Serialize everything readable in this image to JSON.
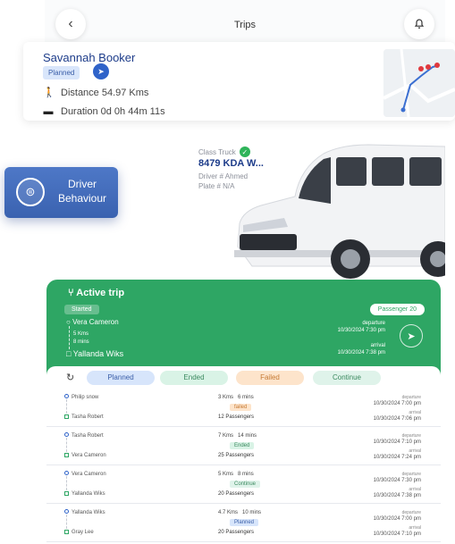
{
  "nav": {
    "title": "Trips",
    "back_icon": "chevron-left-icon",
    "bell_icon": "bell-icon"
  },
  "driver": {
    "name": "Savannah Booker",
    "status": "Planned",
    "distance": "Distance 54.97 Kms",
    "duration": "Duration 0d 0h 44m 11s"
  },
  "behaviour_button": {
    "label_line1": "Driver",
    "label_line2": "Behaviour"
  },
  "vehicle": {
    "class": "Class Truck",
    "plate": "8479 KDA W...",
    "driver": "Driver # Ahmed",
    "plate_no": "Plate # N/A"
  },
  "active_trip": {
    "title": "Active trip",
    "status": "Started",
    "passengers": "Passenger 20",
    "from": "Vera Cameron",
    "distance": "5 Kms",
    "duration": "8 mins",
    "to": "Yallanda Wiks",
    "departure_label": "departure",
    "departure_time": "10/30/2024 7:30 pm",
    "arrival_label": "arrival",
    "arrival_time": "10/30/2024 7:38 pm"
  },
  "filters": [
    "Planned",
    "Ended",
    "Failed",
    "Continue"
  ],
  "trips": [
    {
      "from": "Philip snow",
      "to": "Tasha Robert",
      "distance": "3 Kms",
      "duration": "6 mins",
      "status": "failed",
      "passengers": "12 Passengers",
      "dep_label": "departure",
      "departure": "10/30/2024 7:00 pm",
      "arr_label": "arrival",
      "arrival": "10/30/2024 7:06 pm"
    },
    {
      "from": "Tasha Robert",
      "to": "Vera Cameron",
      "distance": "7 Kms",
      "duration": "14 mins",
      "status": "Ended",
      "passengers": "25 Passengers",
      "dep_label": "departure",
      "departure": "10/30/2024 7:10 pm",
      "arr_label": "arrival",
      "arrival": "10/30/2024 7:24 pm"
    },
    {
      "from": "Vera Cameron",
      "to": "Yallanda Wiks",
      "distance": "5 Kms",
      "duration": "8 mins",
      "status": "Continue",
      "passengers": "20 Passengers",
      "dep_label": "departure",
      "departure": "10/30/2024 7:30 pm",
      "arr_label": "arrival",
      "arrival": "10/30/2024 7:38 pm"
    },
    {
      "from": "Yallanda Wiks",
      "to": "Gray Lee",
      "distance": "4.7 Kms",
      "duration": "10 mins",
      "status": "Planned",
      "passengers": "20 Passengers",
      "dep_label": "departure",
      "departure": "10/30/2024 7:00 pm",
      "arr_label": "arrival",
      "arrival": "10/30/2024 7:10 pm"
    }
  ],
  "colors": {
    "brand_blue": "#2f63c9",
    "active_green": "#2ea664",
    "planned": "#d7e5fb",
    "failed": "#fde4cb"
  }
}
